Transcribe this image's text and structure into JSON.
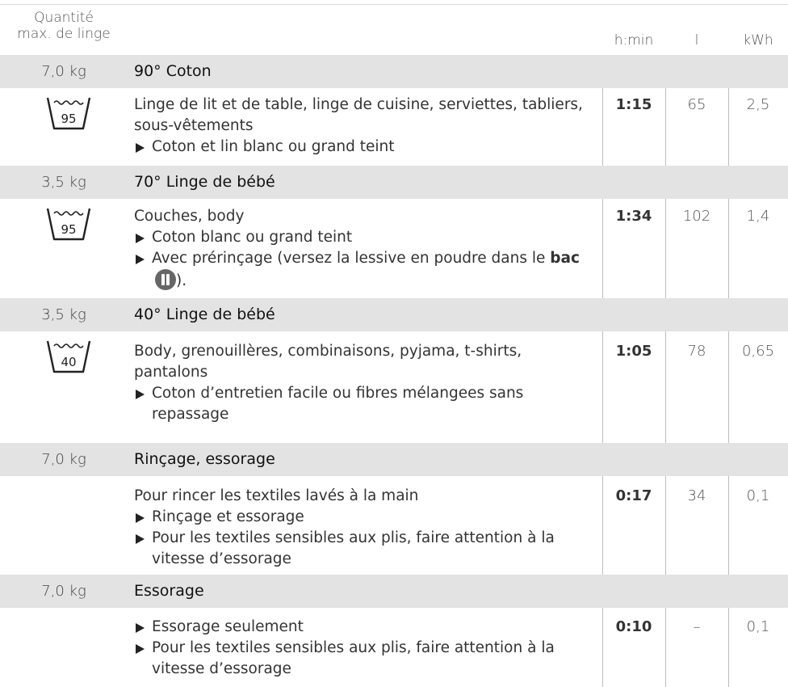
{
  "header": {
    "quantity_line1": "Quantité",
    "quantity_line2": "max. de linge",
    "col_time": "h:min",
    "col_water": "l",
    "col_energy": "kWh"
  },
  "programs": [
    {
      "load": "7,0 kg",
      "title": "90° Coton",
      "symbol": "95",
      "desc": "Linge de lit et de table, linge de cuisine, serviettes, tabliers, sous-vêtements",
      "bullets": [
        "Coton et lin blanc ou grand teint"
      ],
      "time": "1:15",
      "water": "65",
      "energy": "2,5"
    },
    {
      "load": "3,5 kg",
      "title": "70° Linge de bébé",
      "symbol": "95",
      "desc": "Couches, body",
      "bullets": [
        "Coton blanc ou grand teint",
        "Avec prérinçage (versez la lessive en poudre dans le"
      ],
      "bullet_tail_bold": "bac",
      "bullet_tail_end": ").",
      "time": "1:34",
      "water": "102",
      "energy": "1,4"
    },
    {
      "load": "3,5 kg",
      "title": "40° Linge de bébé",
      "symbol": "40",
      "desc": "Body, grenouillères, combinaisons, pyjama, t-shirts, pantalons",
      "bullets": [
        "Coton d’entretien facile ou fibres mélangees sans repassage"
      ],
      "time": "1:05",
      "water": "78",
      "energy": "0,65"
    },
    {
      "load": "7,0 kg",
      "title": "Rinçage, essorage",
      "desc": "Pour rincer les textiles lavés à la main",
      "bullets": [
        "Rinçage et essorage",
        "Pour les textiles sensibles aux plis, faire attention à la vitesse d’essorage"
      ],
      "time": "0:17",
      "water": "34",
      "energy": "0,1"
    },
    {
      "load": "7,0 kg",
      "title": "Essorage",
      "bullets": [
        "Essorage seulement",
        "Pour les textiles sensibles aux plis, faire attention à la vitesse d’essorage"
      ],
      "time": "0:10",
      "water": "–",
      "energy": "0,1"
    }
  ],
  "icons": {
    "wash_tub": "wash-tub-icon",
    "compartment_badge": "compartment-2-icon"
  },
  "colors": {
    "band": "#e3e3e3",
    "divider": "#bdbdbd",
    "text": "#333333"
  }
}
